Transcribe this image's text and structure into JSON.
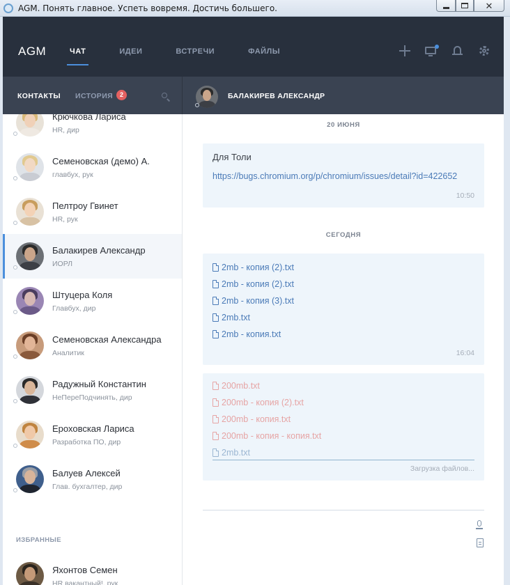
{
  "window": {
    "title": "AGM. Понять главное. Успеть вовремя. Достичь большего."
  },
  "app": {
    "logo": "AGM",
    "nav": [
      {
        "label": "ЧАТ",
        "active": true
      },
      {
        "label": "ИДЕИ",
        "active": false
      },
      {
        "label": "ВСТРЕЧИ",
        "active": false
      },
      {
        "label": "ФАЙЛЫ",
        "active": false
      }
    ],
    "icons": [
      "plus-icon",
      "screen-share-icon",
      "bell-icon",
      "gear-icon"
    ],
    "accent": "#4b8fdc"
  },
  "sidebar": {
    "tabs": {
      "contacts": "КОНТАКТЫ",
      "history": "ИСТОРИЯ",
      "history_badge": "2"
    },
    "contacts": [
      {
        "name": "Крючкова Лариса",
        "role": "HR, дир"
      },
      {
        "name": "Семеновская (демо) А.",
        "role": "главбух, рук"
      },
      {
        "name": "Пелтроу Гвинет",
        "role": "HR, рук"
      },
      {
        "name": "Балакирев Александр",
        "role": "ИОРЛ",
        "active": true
      },
      {
        "name": "Штуцера Коля",
        "role": "Главбух, дир"
      },
      {
        "name": "Семеновская Александра",
        "role": "Аналитик"
      },
      {
        "name": "Радужный Константин",
        "role": "НеПереПодчинять, дир"
      },
      {
        "name": "Ероховская Лариса",
        "role": "Разработка ПО, дир"
      },
      {
        "name": "Балуев Алексей",
        "role": "Глав. бухгалтер, дир"
      }
    ],
    "favorites_label": "ИЗБРАННЫЕ",
    "favorites": [
      {
        "name": "Яхонтов Семен",
        "role": "HR вакантный!, рук"
      }
    ]
  },
  "chat": {
    "header_name": "БАЛАКИРЕВ АЛЕКСАНДР",
    "sections": [
      {
        "date": "20 ИЮНЯ",
        "message": {
          "text": "Для Толи",
          "link": "https://bugs.chromium.org/p/chromium/issues/detail?id=422652",
          "time": "10:50"
        }
      },
      {
        "date": "СЕГОДНЯ",
        "files_message": {
          "files": [
            "2mb - копия (2).txt",
            "2mb - копия (2).txt",
            "2mb - копия (3).txt",
            "2mb.txt",
            "2mb - копия.txt"
          ],
          "time": "16:04"
        },
        "upload_message": {
          "files": [
            "200mb.txt",
            "200mb - копия (2).txt",
            "200mb - копия.txt",
            "200mb - копия - копия.txt",
            "2mb.txt"
          ],
          "status": "Загрузка файлов..."
        }
      }
    ]
  }
}
